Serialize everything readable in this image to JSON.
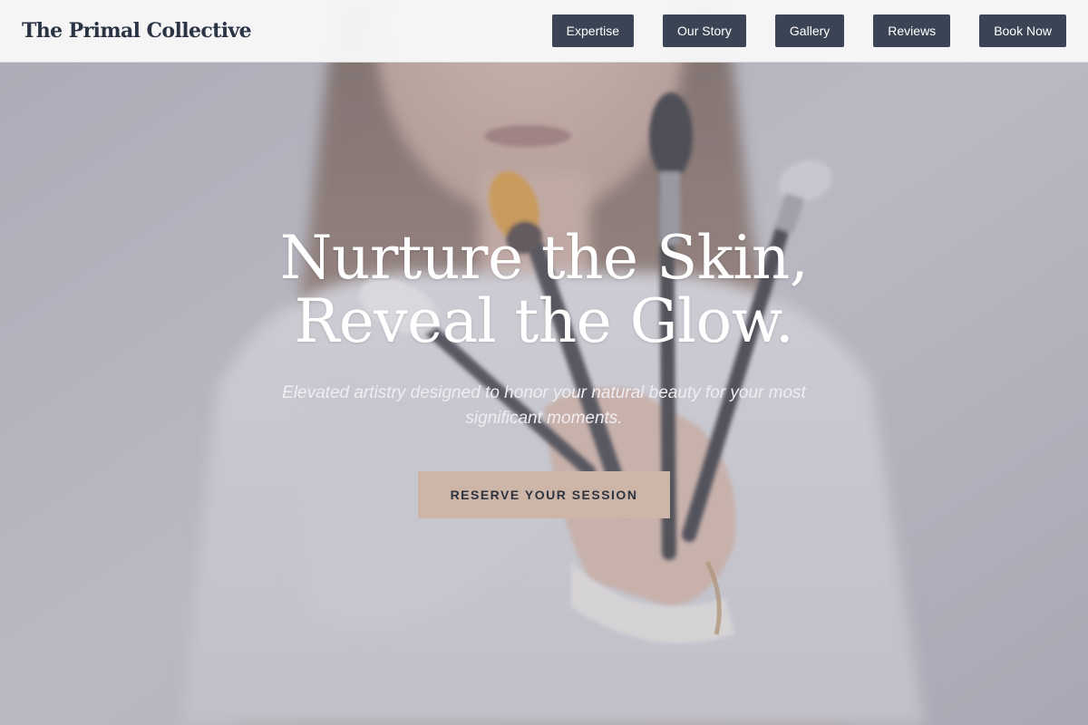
{
  "header": {
    "brand": "The Primal Collective",
    "nav": [
      {
        "label": "Expertise"
      },
      {
        "label": "Our Story"
      },
      {
        "label": "Gallery"
      },
      {
        "label": "Reviews"
      },
      {
        "label": "Book Now"
      }
    ]
  },
  "hero": {
    "headline_line1": "Nurture the Skin,",
    "headline_line2": "Reveal the Glow.",
    "subtext": "Elevated artistry designed to honor your natural beauty for your most significant moments.",
    "cta_label": "RESERVE YOUR SESSION",
    "image_alt": "Makeup artist holding a fan of makeup brushes"
  },
  "colors": {
    "nav_button": "#3b4454",
    "cta_button": "#cdb6a8",
    "brand_text": "#2b3445"
  }
}
